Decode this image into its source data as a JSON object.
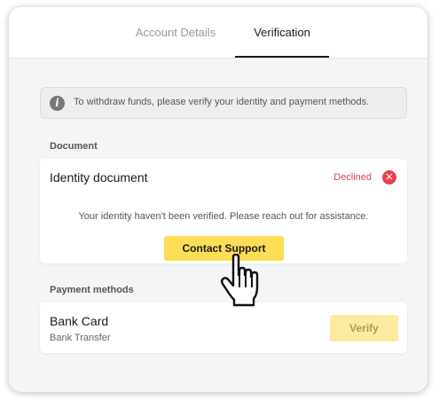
{
  "tabs": [
    {
      "label": "Account Details",
      "active": false
    },
    {
      "label": "Verification",
      "active": true
    }
  ],
  "info_banner": {
    "icon": "info-icon",
    "text": "To withdraw funds, please verify your identity and payment methods."
  },
  "document_section": {
    "label": "Document",
    "title": "Identity document",
    "status": "Declined",
    "status_icon": "close-circle-icon",
    "message": "Your identity haven't been verified. Please reach out for assistance.",
    "button_label": "Contact Support"
  },
  "payment_section": {
    "label": "Payment methods",
    "title": "Bank Card",
    "subtitle": "Bank Transfer",
    "button_label": "Verify"
  },
  "colors": {
    "accent": "#fddd55",
    "accent_disabled": "#fcea9e",
    "declined": "#e0414f"
  },
  "cursor_icon": "hand-pointer-icon"
}
